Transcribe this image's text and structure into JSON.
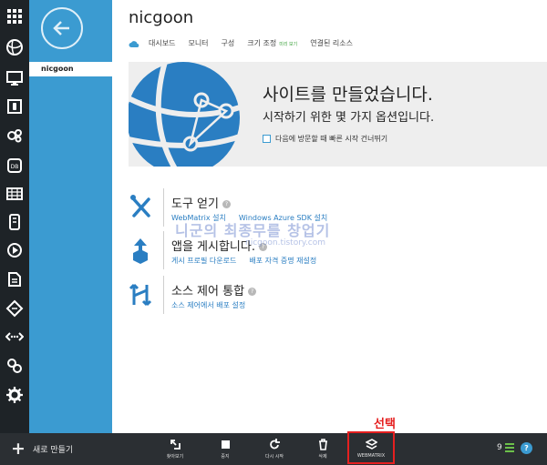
{
  "rail": {
    "items": [
      {
        "icon": "all-items-grid-icon"
      },
      {
        "icon": "web-sites-globe-icon"
      },
      {
        "icon": "virtual-machines-monitor-icon"
      },
      {
        "icon": "mobile-services-icon"
      },
      {
        "icon": "cloud-services-gear-icon"
      },
      {
        "icon": "sql-database-icon",
        "text": "DB"
      },
      {
        "icon": "storage-table-icon"
      },
      {
        "icon": "hdinsight-icon"
      },
      {
        "icon": "media-services-icon"
      },
      {
        "icon": "service-bus-icon"
      },
      {
        "icon": "networks-icon"
      },
      {
        "icon": "traffic-manager-icon"
      },
      {
        "icon": "add-ons-icon"
      },
      {
        "icon": "settings-icon"
      }
    ]
  },
  "subnav": {
    "selected_item": "nicgoon"
  },
  "header": {
    "title": "nicgoon",
    "tabs": [
      {
        "label": "대시보드"
      },
      {
        "label": "모니터"
      },
      {
        "label": "구성"
      },
      {
        "label": "크기 조정",
        "badge": "미리 보기"
      },
      {
        "label": "연결된 리소스"
      }
    ]
  },
  "banner": {
    "heading": "사이트를 만들었습니다.",
    "subheading": "시작하기 위한 몇 가지 옵션입니다.",
    "skip_checkbox_label": "다음에 방문할 때 빠른 시작 건너뛰기",
    "skip_checked": false
  },
  "sections": [
    {
      "icon": "tools-icon",
      "title": "도구 얻기",
      "links": [
        "WebMatrix 설치",
        "Windows Azure SDK 설치"
      ]
    },
    {
      "icon": "publish-icon",
      "title": "앱을 게시합니다.",
      "links": [
        "게시 프로필 다운로드",
        "배포 자격 증명 재설정"
      ]
    },
    {
      "icon": "source-control-icon",
      "title": "소스 제어 통합",
      "links": [
        "소스 제어에서 배포 설정"
      ]
    }
  ],
  "watermark": {
    "text": "니군의 최종무를 창업기",
    "url": "nicgoon.tistory.com"
  },
  "command_bar": {
    "new_label": "새로 만들기",
    "commands": [
      {
        "label": "찾아보기",
        "icon": "browse-icon"
      },
      {
        "label": "중지",
        "icon": "stop-icon"
      },
      {
        "label": "다시 시작",
        "icon": "restart-icon"
      },
      {
        "label": "삭제",
        "icon": "delete-icon"
      },
      {
        "label": "WEBMATRIX",
        "icon": "webmatrix-icon",
        "highlighted": true
      }
    ],
    "callout": "선택",
    "notification_count": "9"
  },
  "colors": {
    "rail_bg": "#1e2327",
    "subnav_bg": "#3b9bd1",
    "accent": "#2a7ec2",
    "highlight": "#e52020",
    "command_bar_bg": "#2b2f33"
  }
}
